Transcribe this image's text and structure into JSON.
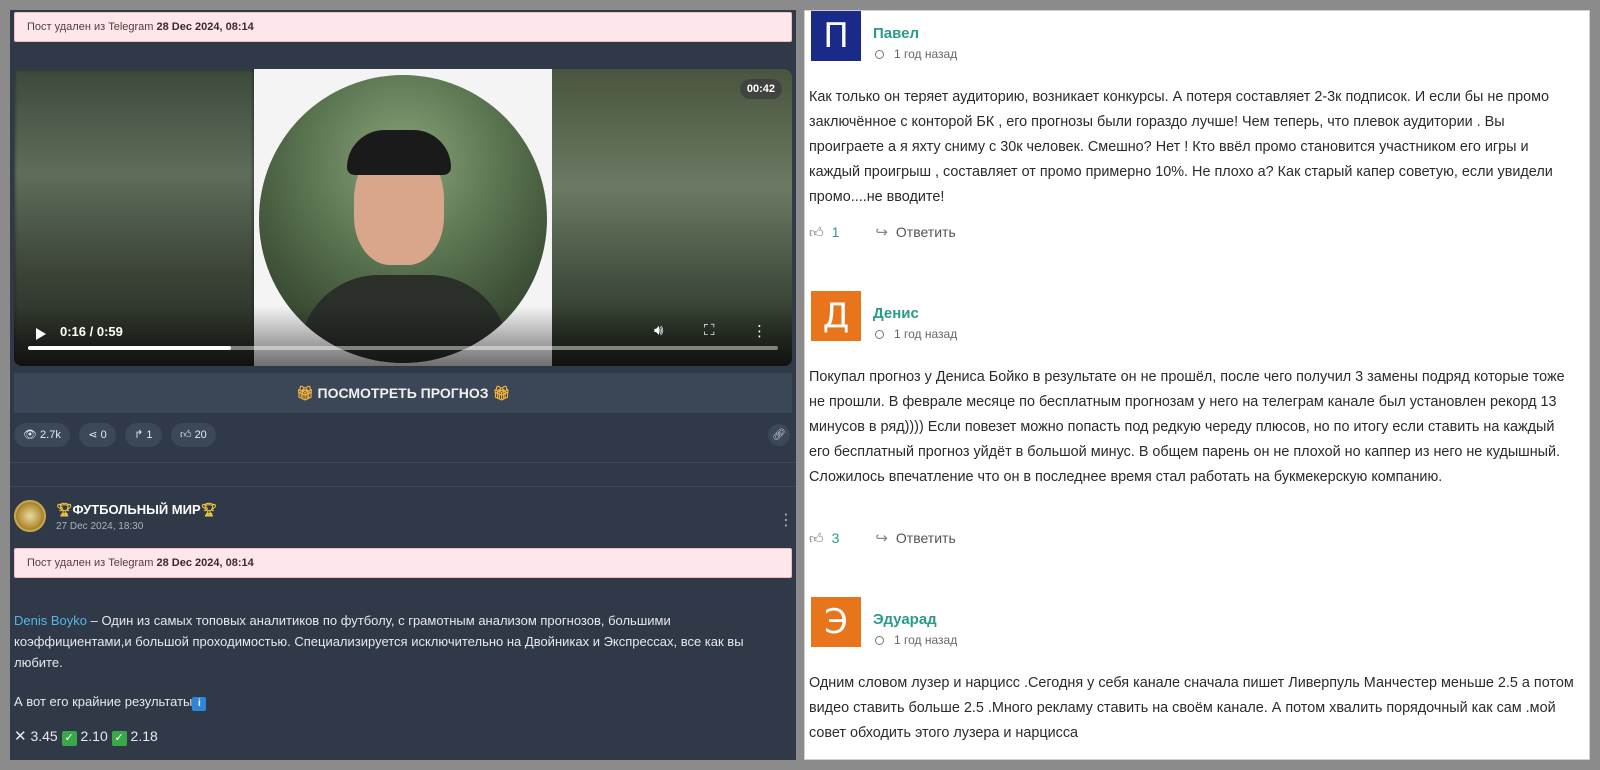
{
  "left": {
    "deleted_notice_1": {
      "text": "Пост удален из Telegram",
      "date": "28 Dec 2024, 08:14"
    },
    "video": {
      "duration_badge": "00:42",
      "time": "0:16 / 0:59",
      "progress_fraction": 0.2712,
      "play_icon": "play-icon",
      "volume_icon": "volume-icon",
      "fullscreen_icon": "fullscreen-icon",
      "more_icon": "more-vertical-icon"
    },
    "cta_label": "ПОСМОТРЕТЬ ПРОГНОЗ",
    "stats": {
      "views": "2.7k",
      "shares": "0",
      "forwards": "1",
      "likes": "20"
    },
    "channel": {
      "name": "ФУТБОЛЬНЫЙ МИР",
      "date": "27 Dec 2024, 18:30"
    },
    "deleted_notice_2": {
      "text": "Пост удален из Telegram",
      "date": "28 Dec 2024, 08:14"
    },
    "post": {
      "author_link": "Denis Boyko",
      "body": " – Один из самых топовых аналитиков по футболу, с грамотным анализом прогнозов, большими коэффициентами,и большой проходимостью. Специализируется исключительно на Двойниках и Экспрессах, все как вы любите.",
      "results_intro": "А вот его крайние результаты",
      "results": [
        "3.45",
        "2.10",
        "2.18"
      ]
    }
  },
  "comments": [
    {
      "avatar_letter": "П",
      "avatar_color": "#1a2a88",
      "name": "Павел",
      "time": "1 год назад",
      "text": "Как только он теряет аудиторию, возникает конкурсы. А потеря составляет 2-3к подписок. И если бы не промо заключённое с конторой БК , его прогнозы были гораздо лучше! Чем теперь, что плевок аудитории . Вы проиграете а я яхту сниму с 30к человек. Смешно? Нет ! Кто ввёл промо становится участником его игры и каждый проигрыш , составляет от промо примерно 10%. Не плохо а? Как старый капер советую, если увидели промо....не вводите!",
      "likes": "1",
      "reply_label": "Ответить"
    },
    {
      "avatar_letter": "Д",
      "avatar_color": "#e8741c",
      "name": "Денис",
      "time": "1 год назад",
      "text": "Покупал прогноз у Дениса Бойко в результате он не прошёл, после чего получил 3 замены подряд которые тоже не прошли. В феврале месяце по бесплатным прогнозам у него на телеграм канале был установлен рекорд 13 минусов в ряд)))) Если повезет можно попасть под редкую череду плюсов, но по итогу если ставить на каждый его бесплатный прогноз уйдёт в большой минус. В общем парень он не плохой но каппер из него не кудышный. Сложилось впечатление что он в последнее время стал работать на букмекерскую компанию.",
      "likes": "3",
      "reply_label": "Ответить"
    },
    {
      "avatar_letter": "Э",
      "avatar_color": "#e8741c",
      "name": "Эдуарад",
      "time": "1 год назад",
      "text": "Одним словом лузер и нарцисс .Сегодня у себя канале сначала пишет Ливерпуль Манчестер меньше 2.5 а потом видео ставить больше 2.5 .Много рекламу ставить на своём канале. А потом хвалить порядочный как сам .мой совет обходить этого лузера и нарцисса",
      "likes": "",
      "reply_label": ""
    }
  ]
}
